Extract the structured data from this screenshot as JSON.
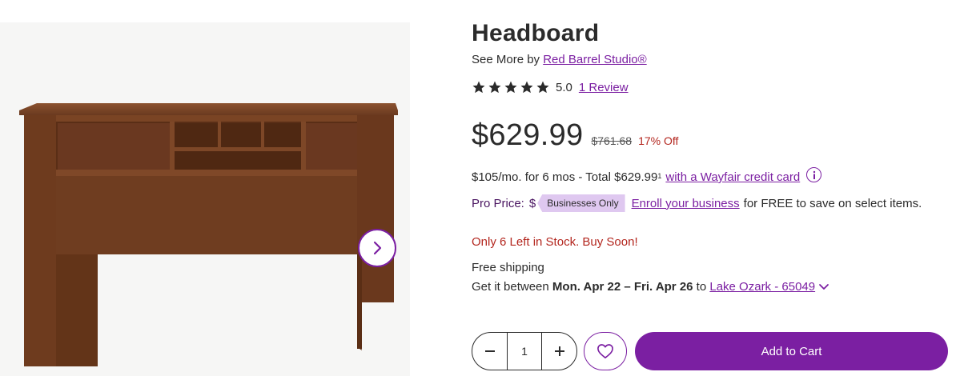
{
  "product": {
    "title": "Headboard",
    "see_more_prefix": "See More by",
    "brand": "Red Barrel Studio®",
    "rating_value": "5.0",
    "rating_stars": 5,
    "reviews_label": "1 Review"
  },
  "pricing": {
    "price": "$629.99",
    "was_price": "$761.68",
    "discount": "17% Off"
  },
  "financing": {
    "text": "$105/mo. for 6 mos - Total $629.99",
    "footnote": "1",
    "link": "with a Wayfair credit card",
    "info_icon": "info-icon"
  },
  "pro": {
    "label": "Pro Price:",
    "masked_price": "$",
    "badge": "Businesses Only",
    "enroll_link": "Enroll your business",
    "tail": "for FREE to save on select items."
  },
  "stock": {
    "message": "Only 6 Left in Stock. Buy Soon!"
  },
  "shipping": {
    "label": "Free shipping",
    "prefix": "Get it between ",
    "date_range": "Mon. Apr 22 – Fri. Apr 26",
    "to": " to ",
    "location": "Lake Ozark - 65049"
  },
  "purchase": {
    "quantity": "1",
    "minus_icon": "minus-icon",
    "plus_icon": "plus-icon",
    "favorite_icon": "heart-icon",
    "add_to_cart": "Add to Cart"
  },
  "gallery": {
    "next_icon": "chevron-right-icon"
  },
  "colors": {
    "accent": "#7b1fa2",
    "sale_red": "#b3261e",
    "badge_bg": "#dfc8f0",
    "wood": "#6b3a1f"
  }
}
